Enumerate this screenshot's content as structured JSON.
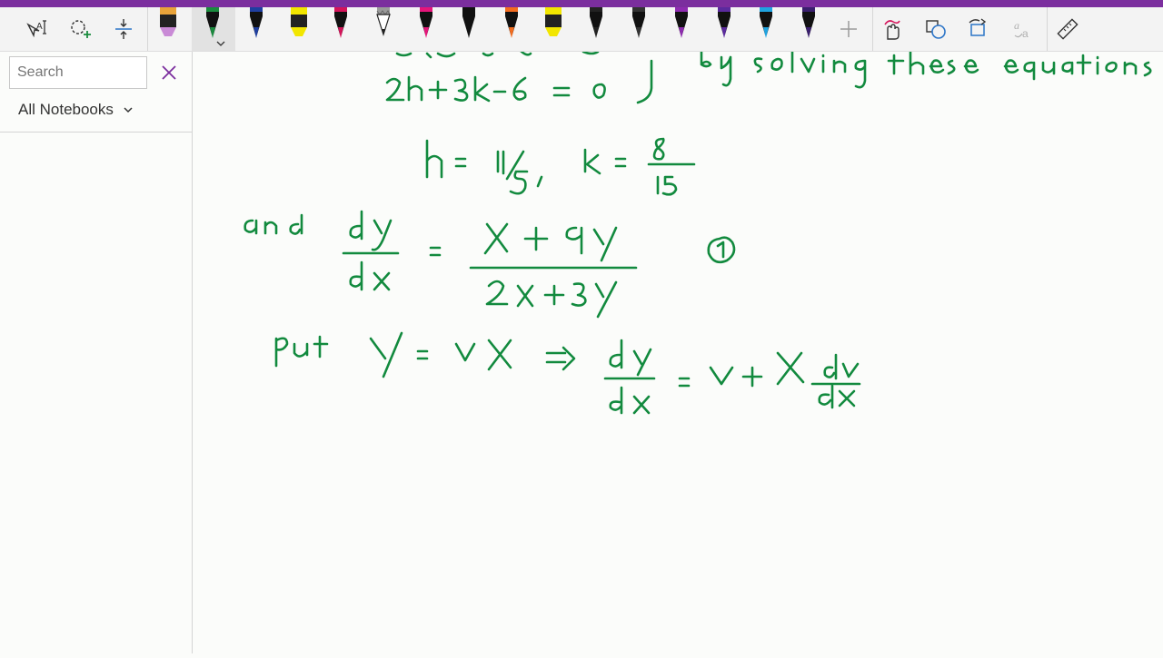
{
  "app": {
    "accent_color": "#7b2e9e"
  },
  "toolbar": {
    "tools": [
      {
        "name": "lasso-text-select",
        "icon": "text-lasso-icon"
      },
      {
        "name": "lasso-select",
        "icon": "lasso-add-icon"
      },
      {
        "name": "add-space",
        "icon": "insert-space-icon"
      }
    ],
    "pens": [
      {
        "color": "#e8a33a",
        "tip": "#c98ad6",
        "kind": "highlighter"
      },
      {
        "color": "#1a8b3e",
        "tip": "#1a8b3e",
        "kind": "pen",
        "selected": true
      },
      {
        "color": "#1f3fa0",
        "tip": "#1f3fa0",
        "kind": "pen"
      },
      {
        "color": "#f2e600",
        "tip": "#f2e600",
        "kind": "highlighter"
      },
      {
        "color": "#d4145a",
        "tip": "#d4145a",
        "kind": "pen"
      },
      {
        "color": "#9a9a9a",
        "tip": "#222222",
        "kind": "pencil"
      },
      {
        "color": "#e5157a",
        "tip": "#e5157a",
        "kind": "pen"
      },
      {
        "color": "#111111",
        "tip": "#111111",
        "kind": "pen"
      },
      {
        "color": "#f26c1f",
        "tip": "#f26c1f",
        "kind": "pen"
      },
      {
        "color": "#f2e600",
        "tip": "#f2e600",
        "kind": "highlighter"
      },
      {
        "color": "#222222",
        "tip": "#222222",
        "kind": "pen"
      },
      {
        "color": "#333333",
        "tip": "#333333",
        "kind": "pen"
      },
      {
        "color": "#8e2bb0",
        "tip": "#8e2bb0",
        "kind": "pen"
      },
      {
        "color": "#5b2a9e",
        "tip": "#5b2a9e",
        "kind": "pen"
      },
      {
        "color": "#1fa3e0",
        "tip": "#1fa3e0",
        "kind": "pen"
      },
      {
        "color": "#3a1f6e",
        "tip": "#3a1f6e",
        "kind": "pen"
      }
    ],
    "right_tools": [
      {
        "name": "add-pen",
        "icon": "plus-icon"
      },
      {
        "name": "touch-draw",
        "icon": "hand-draw-icon"
      },
      {
        "name": "ink-to-shape",
        "icon": "shapes-icon"
      },
      {
        "name": "ink-to-text",
        "icon": "lasso-convert-icon"
      },
      {
        "name": "ink-to-math",
        "icon": "math-convert-icon"
      },
      {
        "name": "ruler",
        "icon": "ruler-icon"
      }
    ]
  },
  "sidebar": {
    "search": {
      "placeholder": "Search",
      "value": ""
    },
    "notebook_filter": "All Notebooks"
  }
}
